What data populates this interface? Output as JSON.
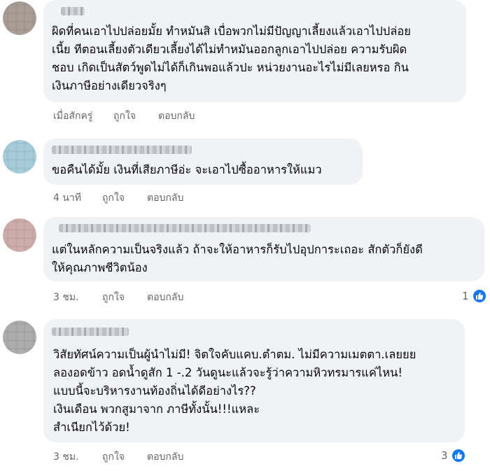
{
  "comments": [
    {
      "lines": [
        "ผิดที่คนเอาไปปล่อยมั้ย  ทำหมันสิ เบื่อพวกไม่มีปัญญาเลี้ยงแล้วเอาไปปล่อย",
        "เนี้ย  ทีตอนเลี้ยงตัวเดียวเลี้ยงได้ไม่ทำหมันออกลูกเอาไปปล่อย  ความรับผิด",
        "ชอบ  เกิดเป็นสัตว์พูดไม่ได้ก็เกินพอแล้วปะ  หน่วยงานอะไรไม่มีเลยหรอ  กิน",
        "เงินภาษีอย่างเดียวจริงๆ"
      ],
      "time": "เมื่อสักครู่",
      "like_label": "ถูกใจ",
      "reply_label": "ตอบกลับ",
      "avatar_color": "#8c7d72"
    },
    {
      "lines": [
        "ขอคืนได้มั้ย เงินที่เสียภาษีอ่ะ จะเอาไปซื้ออาหารให้แมว"
      ],
      "time": "4 นาที",
      "like_label": "ถูกใจ",
      "reply_label": "ตอบกลับ",
      "avatar_color": "#7fb6c7"
    },
    {
      "lines": [
        "แต่ในหลักความเป็นจริงแล้ว ถ้าจะให้อาหารก็รับไปอุปการะเถอะ สักตัวก็ยังดี",
        "ให้คุณภาพชีวิตน้อง"
      ],
      "time": "3 ชม.",
      "like_label": "ถูกใจ",
      "reply_label": "ตอบกลับ",
      "reaction_count": "1",
      "avatar_color": "#b88a86"
    },
    {
      "lines": [
        "วิสัยทัศน์ความเป็นผู้นำไม่มี!  จิตใจคับแคบ.ตำตม. ไม่มีความเมตตา.เลยยย",
        "ลองอดข้าว อดน้ำดูสัก  1 -.2 วันดูนะแล้วจะรู้ว่าความหิวทรมารแค่ไหน!",
        " แบบนี้จะบริหารงานท้องถิ่นได้ดีอย่างไร??",
        " เงินเดือน พวกสูมาจาก ภาษีทั้งนั้น!!!แหละ",
        "สำเนียกไว้ด้วย!"
      ],
      "time": "3 ชม.",
      "like_label": "ถูกใจ",
      "reply_label": "ตอบกลับ",
      "reaction_count": "3",
      "avatar_color": "#8a8a8a"
    }
  ],
  "icons": {
    "like": "thumbs-up-icon"
  },
  "colors": {
    "bubble": "#f0f2f5",
    "meta_text": "#65676b",
    "like_blue": "#1877f2"
  }
}
